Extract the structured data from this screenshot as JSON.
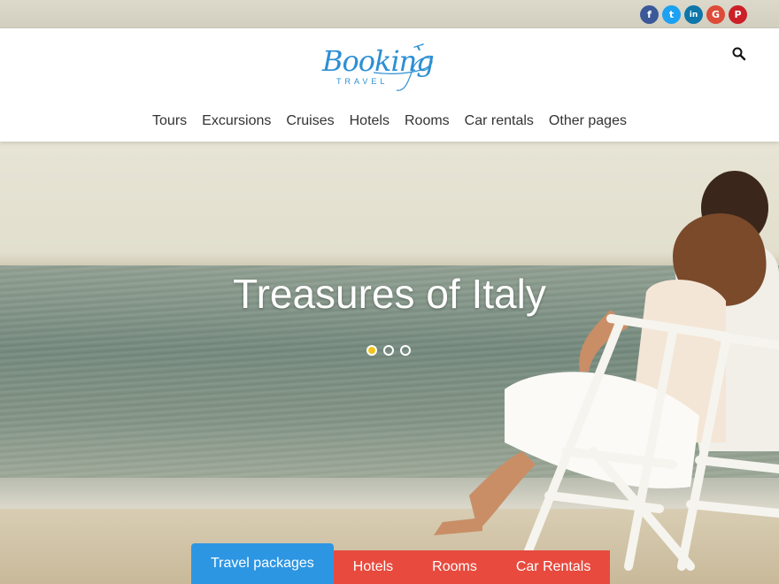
{
  "social": {
    "items": [
      {
        "name": "facebook",
        "glyph": "f",
        "color": "#3b5998"
      },
      {
        "name": "twitter",
        "glyph": "t",
        "color": "#1da1f2"
      },
      {
        "name": "linkedin",
        "glyph": "in",
        "color": "#0e76a8"
      },
      {
        "name": "google",
        "glyph": "G",
        "color": "#dd4b39"
      },
      {
        "name": "pinterest",
        "glyph": "P",
        "color": "#cb2027"
      }
    ]
  },
  "header": {
    "logo_word": "Booking",
    "logo_sub": "TRAVEL",
    "nav": [
      "Tours",
      "Excursions",
      "Cruises",
      "Hotels",
      "Rooms",
      "Car rentals",
      "Other pages"
    ]
  },
  "hero": {
    "title": "Treasures of Italy",
    "slides_total": 3,
    "active_slide": 1
  },
  "tabs": {
    "items": [
      "Travel packages",
      "Hotels",
      "Rooms",
      "Car Rentals"
    ],
    "active": 0
  },
  "colors": {
    "accent_blue": "#2d96e3",
    "accent_red": "#e84a3e",
    "dot_active": "#f3c51c",
    "logo_blue": "#2c8fd3"
  }
}
